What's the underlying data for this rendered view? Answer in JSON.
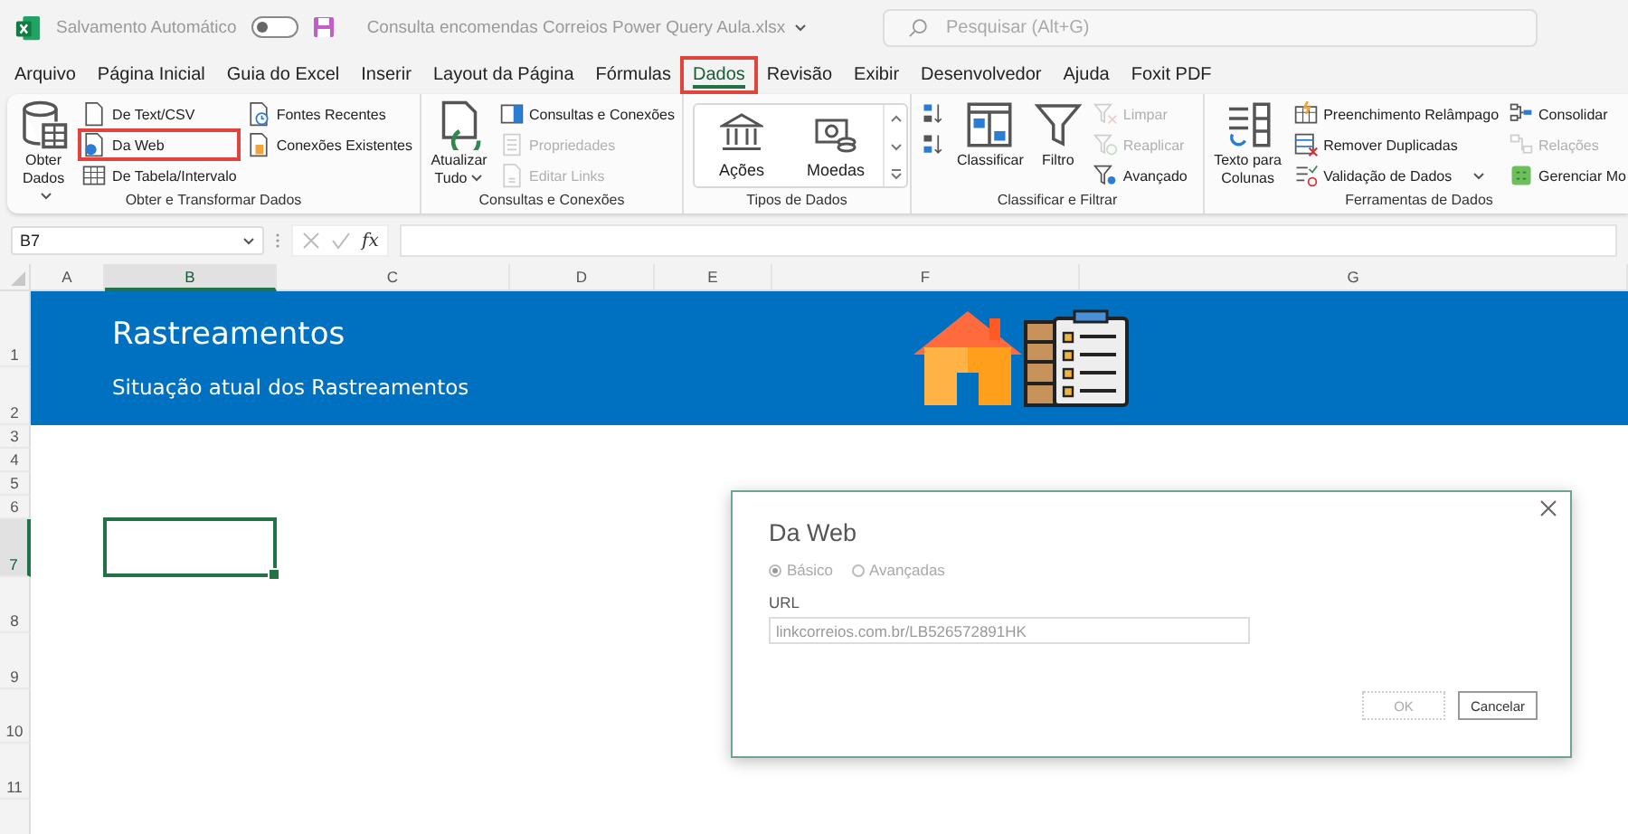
{
  "title_bar": {
    "autosave": {
      "label": "Salvamento Automático",
      "on": false
    },
    "filename": "Consulta encomendas Correios Power Query Aula.xlsx",
    "search": {
      "placeholder": "Pesquisar (Alt+G)"
    }
  },
  "menu_tabs": [
    {
      "label": "Arquivo",
      "selected": false,
      "highlighted": false
    },
    {
      "label": "Página Inicial",
      "selected": false,
      "highlighted": false
    },
    {
      "label": "Guia do Excel",
      "selected": false,
      "highlighted": false
    },
    {
      "label": "Inserir",
      "selected": false,
      "highlighted": false
    },
    {
      "label": "Layout da Página",
      "selected": false,
      "highlighted": false
    },
    {
      "label": "Fórmulas",
      "selected": false,
      "highlighted": false
    },
    {
      "label": "Dados",
      "selected": true,
      "highlighted": true
    },
    {
      "label": "Revisão",
      "selected": false,
      "highlighted": false
    },
    {
      "label": "Exibir",
      "selected": false,
      "highlighted": false
    },
    {
      "label": "Desenvolvedor",
      "selected": false,
      "highlighted": false
    },
    {
      "label": "Ajuda",
      "selected": false,
      "highlighted": false
    },
    {
      "label": "Foxit PDF",
      "selected": false,
      "highlighted": false
    }
  ],
  "ribbon": {
    "groups": [
      {
        "label": "Obter e Transformar Dados",
        "kind": "commands",
        "columns": [
          [
            {
              "label": "Obter Dados",
              "kind": "large",
              "dropdown": true,
              "disabled": false,
              "highlighted": false
            }
          ],
          [
            {
              "label": "De Text/CSV",
              "kind": "small",
              "dropdown": false,
              "disabled": false,
              "highlighted": false
            },
            {
              "label": "Da Web",
              "kind": "small",
              "dropdown": false,
              "disabled": false,
              "highlighted": true
            },
            {
              "label": "De Tabela/Intervalo",
              "kind": "small",
              "dropdown": false,
              "disabled": false,
              "highlighted": false
            }
          ],
          [
            {
              "label": "Fontes Recentes",
              "kind": "small",
              "dropdown": false,
              "disabled": false,
              "highlighted": false
            },
            {
              "label": "Conexões Existentes",
              "kind": "small",
              "dropdown": false,
              "disabled": false,
              "highlighted": false
            }
          ]
        ]
      },
      {
        "label": "Consultas e Conexões",
        "kind": "commands",
        "columns": [
          [
            {
              "label": "Atualizar Tudo",
              "kind": "large",
              "dropdown": true,
              "disabled": false,
              "highlighted": false
            }
          ],
          [
            {
              "label": "Consultas e Conexões",
              "kind": "small",
              "dropdown": false,
              "disabled": false,
              "highlighted": false
            },
            {
              "label": "Propriedades",
              "kind": "small",
              "dropdown": false,
              "disabled": true,
              "highlighted": false
            },
            {
              "label": "Editar Links",
              "kind": "small",
              "dropdown": false,
              "disabled": true,
              "highlighted": false
            }
          ]
        ]
      },
      {
        "label": "Tipos de Dados",
        "kind": "gallery",
        "items": [
          {
            "label": "Ações"
          },
          {
            "label": "Moedas"
          }
        ]
      },
      {
        "label": "Classificar e Filtrar",
        "kind": "commands",
        "columns": [
          [
            {
              "kind": "icon",
              "dropdown": false,
              "disabled": false,
              "highlighted": false
            },
            {
              "kind": "icon",
              "dropdown": false,
              "disabled": false,
              "highlighted": false
            }
          ],
          [
            {
              "label": "Classificar",
              "kind": "large",
              "dropdown": false,
              "disabled": false,
              "highlighted": false
            }
          ],
          [
            {
              "label": "Filtro",
              "kind": "large",
              "dropdown": false,
              "disabled": false,
              "highlighted": false
            }
          ],
          [
            {
              "label": "Limpar",
              "kind": "small",
              "dropdown": false,
              "disabled": true,
              "highlighted": false
            },
            {
              "label": "Reaplicar",
              "kind": "small",
              "dropdown": false,
              "disabled": true,
              "highlighted": false
            },
            {
              "label": "Avançado",
              "kind": "small",
              "dropdown": false,
              "disabled": false,
              "highlighted": false
            }
          ]
        ]
      },
      {
        "label": "Ferramentas de Dados",
        "kind": "commands",
        "columns": [
          [
            {
              "label": "Texto para Colunas",
              "kind": "large",
              "dropdown": false,
              "disabled": false,
              "highlighted": false
            }
          ],
          [
            {
              "label": "Preenchimento Relâmpago",
              "kind": "small",
              "dropdown": false,
              "disabled": false,
              "highlighted": false
            },
            {
              "label": "Remover Duplicadas",
              "kind": "small",
              "dropdown": false,
              "disabled": false,
              "highlighted": false
            },
            {
              "label": "Validação de Dados",
              "kind": "small",
              "dropdown": true,
              "disabled": false,
              "highlighted": false
            }
          ],
          [
            {
              "label": "Consolidar",
              "kind": "small",
              "dropdown": false,
              "disabled": false,
              "highlighted": false
            },
            {
              "label": "Relações",
              "kind": "small",
              "dropdown": false,
              "disabled": true,
              "highlighted": false
            },
            {
              "label": "Gerenciar Mo",
              "kind": "small",
              "dropdown": false,
              "disabled": false,
              "highlighted": false
            }
          ]
        ]
      }
    ]
  },
  "formula_bar": {
    "name_box": "B7",
    "function_label": "fx"
  },
  "sheet": {
    "columns": [
      {
        "label": "A",
        "selected": false
      },
      {
        "label": "B",
        "selected": true
      },
      {
        "label": "C",
        "selected": false
      },
      {
        "label": "D",
        "selected": false
      },
      {
        "label": "E",
        "selected": false
      },
      {
        "label": "F",
        "selected": false
      },
      {
        "label": "G",
        "selected": false
      }
    ],
    "rows": [
      {
        "label": "1",
        "selected": false
      },
      {
        "label": "2",
        "selected": false
      },
      {
        "label": "3",
        "selected": false
      },
      {
        "label": "4",
        "selected": false
      },
      {
        "label": "5",
        "selected": false
      },
      {
        "label": "6",
        "selected": false
      },
      {
        "label": "7",
        "selected": true
      },
      {
        "label": "8",
        "selected": false
      },
      {
        "label": "9",
        "selected": false
      },
      {
        "label": "10",
        "selected": false
      },
      {
        "label": "11",
        "selected": false
      }
    ],
    "banner": {
      "title": "Rastreamentos",
      "subtitle": "Situação atual dos Rastreamentos"
    }
  },
  "dialog": {
    "title": "Da Web",
    "options": [
      {
        "label": "Básico",
        "selected": true
      },
      {
        "label": "Avançadas",
        "selected": false
      }
    ],
    "field_label": "URL",
    "url": "linkcorreios.com.br/LB526572891HK",
    "buttons": [
      {
        "label": "OK",
        "disabled": true
      },
      {
        "label": "Cancelar",
        "disabled": false
      }
    ]
  }
}
